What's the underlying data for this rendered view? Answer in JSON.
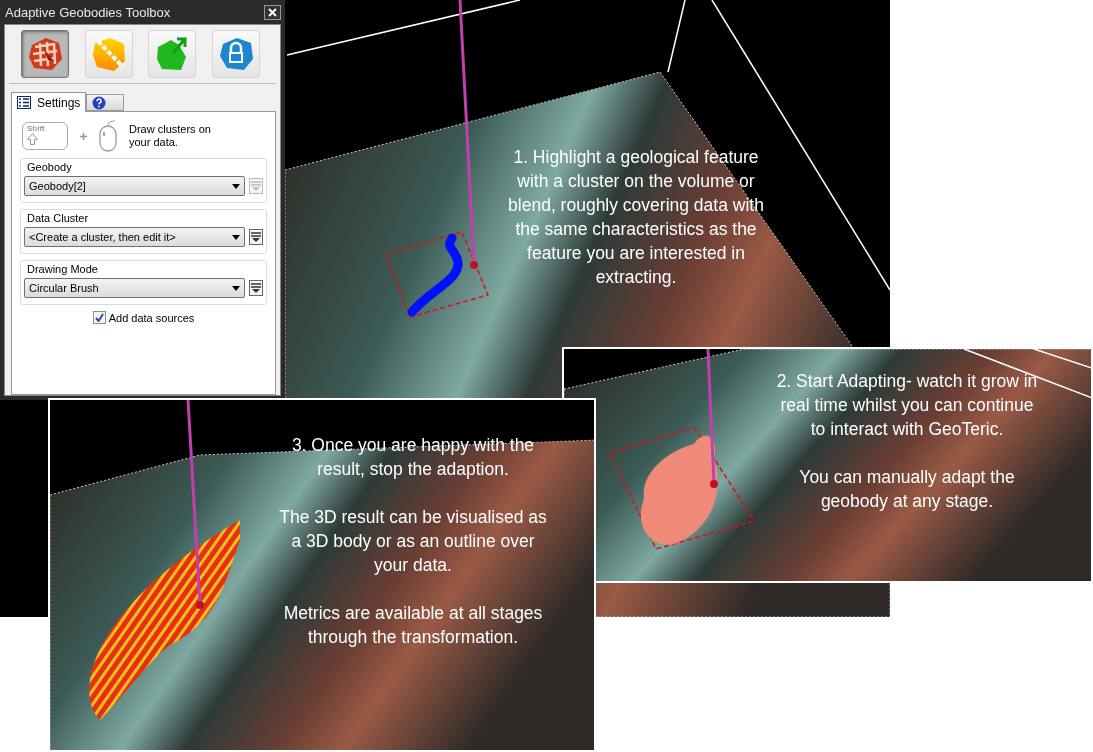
{
  "toolbox": {
    "title": "Adaptive Geobodies Toolbox",
    "tools": [
      {
        "kind": "cluster",
        "selected": true
      },
      {
        "kind": "split",
        "selected": false
      },
      {
        "kind": "grow",
        "selected": false
      },
      {
        "kind": "lock",
        "selected": false
      }
    ],
    "tabs": [
      {
        "kind": "settings",
        "label": "Settings",
        "selected": true
      },
      {
        "kind": "help",
        "selected": false
      }
    ],
    "shortcut": {
      "key": "Shift",
      "text": "Draw clusters on your data."
    },
    "groups": [
      {
        "title": "Geobody",
        "value": "Geobody[2]",
        "menu_disabled": true
      },
      {
        "title": "Data Cluster",
        "value": "<Create a cluster, then edit it>",
        "menu_disabled": false
      },
      {
        "title": "Drawing Mode",
        "value": "Circular Brush",
        "menu_disabled": false
      }
    ],
    "checkbox": {
      "label": "Add data sources",
      "checked": true
    }
  },
  "views": [
    {
      "kind": "seed",
      "caption": [
        "1. Highlight a geological feature with a cluster on the volume or blend, roughly covering data with the same characteristics as the feature you are interested in extracting."
      ]
    },
    {
      "kind": "growing",
      "caption": [
        "2. Start Adapting- watch it grow in real time whilst you can continue to interact with GeoTeric.",
        "You can manually adapt the geobody at any stage."
      ]
    },
    {
      "kind": "result",
      "caption": [
        "3. Once you are happy with the result, stop the adaption.",
        "The 3D result can be visualised as a 3D body or as an outline over your data.",
        "Metrics are available at all stages through the transformation."
      ]
    }
  ]
}
